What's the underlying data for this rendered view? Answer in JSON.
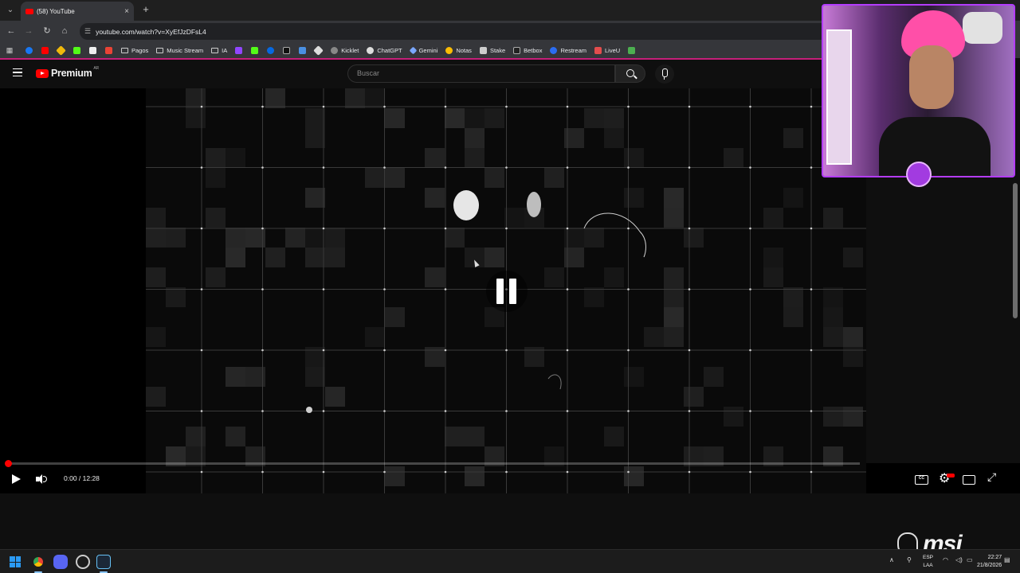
{
  "browser": {
    "tab_title": "(58) YouTube",
    "url": "youtube.com/watch?v=XyEfJzDFsL4",
    "bookmarks": [
      "Pagos",
      "Music Stream",
      "IA",
      "Kicklet",
      "ChatGPT",
      "Gemini",
      "Notas",
      "Stake",
      "Betbox",
      "Restream",
      "LiveU"
    ]
  },
  "youtube": {
    "logo_text": "Premium",
    "region_badge": "AR",
    "search_placeholder": "Buscar"
  },
  "player": {
    "time_current": "0:00",
    "time_separator": " / ",
    "time_total": "12:28",
    "progress_fraction": 0.0,
    "state": "paused"
  },
  "taskbar": {
    "lang_line1": "ESP",
    "lang_line2": "LAA",
    "clock_time": "22:27",
    "clock_date": "21/8/2026"
  },
  "watermark": {
    "brand": "msi"
  },
  "colors": {
    "youtube_red": "#ff0000",
    "accent_pink": "#c51f7a",
    "webcam_border": "#b43cff"
  }
}
